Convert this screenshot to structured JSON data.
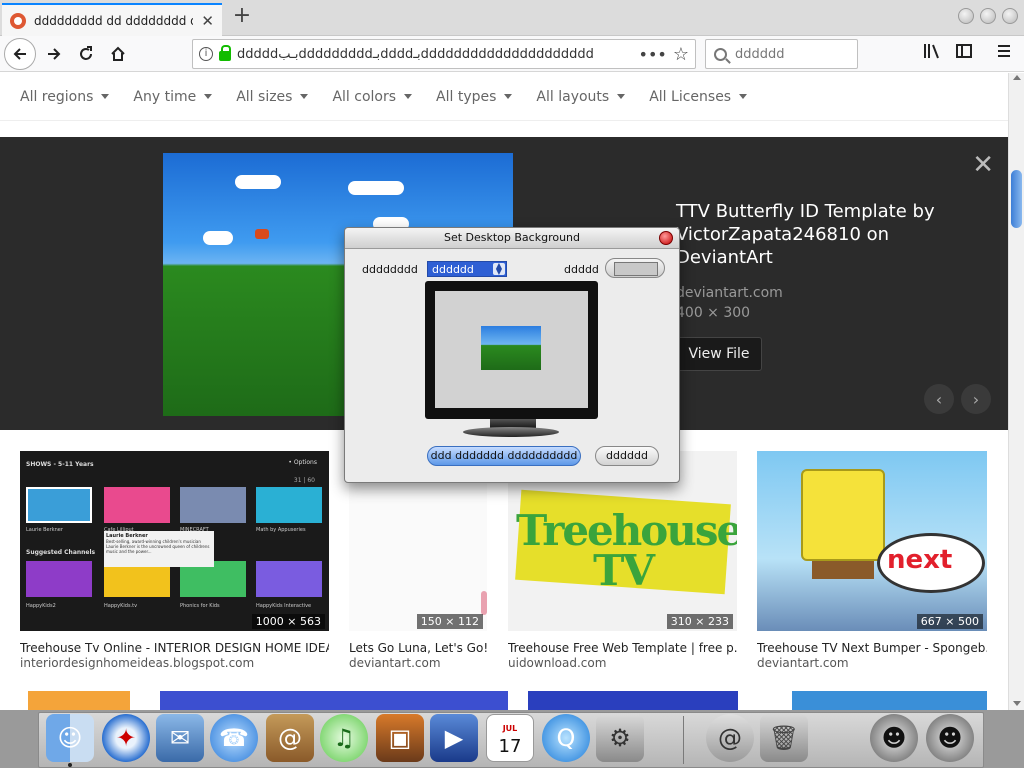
{
  "browser": {
    "tab_title": "ddddddddd dd dddddddd dd dddddddd",
    "url": "dddddبـبdddddddddبـddddبـddddddddddddddddddddd",
    "search_placeholder": "dddddd",
    "new_tab_label": "+",
    "tab_close": "✕"
  },
  "filters": [
    {
      "label": "All regions"
    },
    {
      "label": "Any time"
    },
    {
      "label": "All sizes"
    },
    {
      "label": "All colors"
    },
    {
      "label": "All types"
    },
    {
      "label": "All layouts"
    },
    {
      "label": "All Licenses"
    }
  ],
  "detail": {
    "title": "TTV Butterfly ID Template by VictorZapata246810 on DeviantArt",
    "domain": "deviantart.com",
    "size": "400 × 300",
    "view_button": "View File",
    "close": "✕",
    "prev": "‹",
    "next": "›"
  },
  "results": [
    {
      "title": "Treehouse Tv Online - INTERIOR DESIGN HOME IDEAS",
      "domain": "interiordesignhomeideas.blogspot.com",
      "size": "1000 × 563"
    },
    {
      "title": "Lets Go Luna, Let's Go!...",
      "domain": "deviantart.com",
      "size": "150 × 112"
    },
    {
      "title": "Treehouse Free Web Template | free p...",
      "domain": "uidownload.com",
      "size": "310 × 233"
    },
    {
      "title": "Treehouse TV Next Bumper - Spongeb...",
      "domain": "deviantart.com",
      "size": "667 × 500"
    }
  ],
  "thumb_text": {
    "t1_header": "SHOWS - 5-11 Years",
    "t1_options": "• Options",
    "t1_count": "31 | 60",
    "t1_row1": [
      "Laurie Berkner",
      "Cafe Lilliput",
      "MINECRAFT",
      "Math by Appuseries"
    ],
    "t1_suggested": "Suggested Channels",
    "t1_row2": [
      "HappyKids2",
      "HappyKids.tv",
      "Phonics for Kids",
      "HappyKids Interactive"
    ],
    "t1_tooltip_title": "Laurie Berkner",
    "t1_tooltip_body": "Best-selling, award-winning children's musician Laurie Berkner is the uncrowned queen of childrens music and the power...",
    "t3_text": "Treehouse TV",
    "t4_text": "next"
  },
  "dialog": {
    "title": "Set Desktop Background",
    "left_label": "dddddddd",
    "select_value": "dddddd",
    "right_label": "ddddd",
    "primary_button": "ddd ddddddd dddddddddd",
    "secondary_button": "dddddd"
  },
  "dock": {
    "items": [
      "finder-icon",
      "safari-icon",
      "mail-icon",
      "ichat-icon",
      "address-book-icon",
      "itunes-icon",
      "iphoto-icon",
      "imovie-icon",
      "ical-icon",
      "quicktime-icon",
      "system-preferences-icon",
      "mail-at-icon",
      "trash-icon",
      "raccoon-icon-1",
      "raccoon-icon-2"
    ],
    "ical_month": "JUL",
    "ical_day": "17"
  },
  "colors": {
    "accent": "#0a84ff",
    "detail_bg": "#2b2b2b",
    "dialog_primary": "#5d98e8"
  }
}
